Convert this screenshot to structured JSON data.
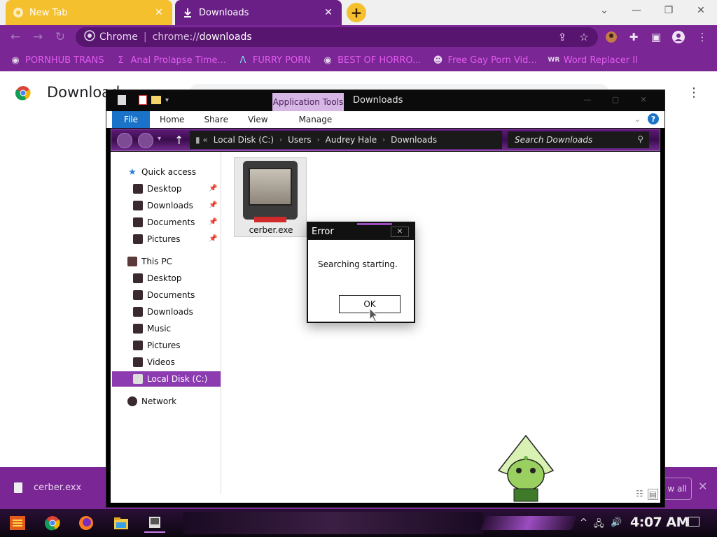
{
  "browser": {
    "tabs": [
      {
        "title": "New Tab",
        "active": false
      },
      {
        "title": "Downloads",
        "active": true
      }
    ],
    "omnibox": {
      "site": "Chrome",
      "scheme": "chrome://",
      "path": "downloads"
    },
    "bookmarks": [
      {
        "label": "PORNHUB TRANS",
        "icon": "globe-icon"
      },
      {
        "label": "Anal Prolapse Time...",
        "icon": "bookmark-icon"
      },
      {
        "label": "FURRY PORN",
        "icon": "lambda-icon"
      },
      {
        "label": "BEST OF HORRO...",
        "icon": "globe-icon"
      },
      {
        "label": "Free Gay Porn Vid...",
        "icon": "mascot-icon"
      },
      {
        "label": "Word Replacer II",
        "icon": "wr-icon"
      }
    ],
    "colors": {
      "accent": "#7a2694",
      "tab_yellow": "#f4c02e"
    }
  },
  "downloads_page": {
    "title": "Download",
    "download_bar": {
      "file_name": "cerber.exx",
      "show_all": "w all"
    }
  },
  "explorer": {
    "title": "Downloads",
    "app_tools": "Application Tools",
    "ribbon_tabs": [
      "File",
      "Home",
      "Share",
      "View",
      "Manage"
    ],
    "breadcrumbs": [
      "Local Disk (C:)",
      "Users",
      "Audrey Hale",
      "Downloads"
    ],
    "search_placeholder": "Search Downloads",
    "nav": {
      "quick_access": "Quick access",
      "quick_items": [
        "Desktop",
        "Downloads",
        "Documents",
        "Pictures"
      ],
      "this_pc": "This PC",
      "pc_items": [
        "Desktop",
        "Documents",
        "Downloads",
        "Music",
        "Pictures",
        "Videos",
        "Local Disk (C:)"
      ],
      "network": "Network",
      "selected": "Local Disk (C:)"
    },
    "files": [
      {
        "name": "cerber.exe"
      }
    ]
  },
  "dialog": {
    "title": "Error",
    "message": "Searching starting.",
    "ok_label": "OK"
  },
  "taskbar": {
    "time": "4:07 AM"
  }
}
